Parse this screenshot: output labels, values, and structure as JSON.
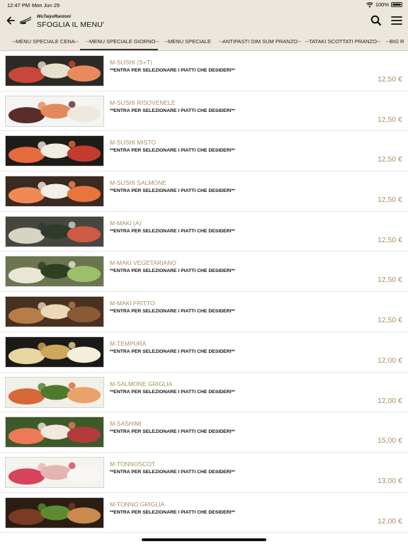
{
  "status": {
    "time": "12:47 PM",
    "date": "Mon Jun 29",
    "battery": "100%"
  },
  "header": {
    "brand": "WuTaiyoRanzoni",
    "title": "SFOGLIA IL MENU'"
  },
  "tabs": [
    {
      "label": "--MENU SPECIALE CENA--"
    },
    {
      "label": "--MENU SPECIALE GIORNO--"
    },
    {
      "label": "--MENU SPECIALE"
    },
    {
      "label": "--ANTIPASTI DIM SUM PRANZO--"
    },
    {
      "label": "--TATAKI SCOTTATI PRANZO--"
    },
    {
      "label": "--BIG R"
    }
  ],
  "items": [
    {
      "name": "M-SUSHI (S+T)",
      "desc": "**ENTRA PER SELEZIONARE I PIATTI CHE DESIDERI**",
      "price": "12,50 €",
      "colors": [
        "#2c2a24",
        "#c9463a",
        "#e8e0cf",
        "#e98a5e"
      ]
    },
    {
      "name": "M-SUSHI RISOVENELE",
      "desc": "**ENTRA PER SELEZIONARE I PIATTI CHE DESIDERI**",
      "price": "12,50 €",
      "colors": [
        "#f4f4f2",
        "#5a2d2a",
        "#e28a5b",
        "#efe9dd"
      ]
    },
    {
      "name": "M-SUSHI MISTO",
      "desc": "**ENTRA PER SELEZIONARE I PIATTI CHE DESIDERI**",
      "price": "12,50 €",
      "colors": [
        "#1e1c18",
        "#e56a3e",
        "#f1ece0",
        "#c63b2f"
      ]
    },
    {
      "name": "M-SUSHI SALMONE",
      "desc": "**ENTRA PER SELEZIONARE I PIATTI CHE DESIDERI**",
      "price": "12,50 €",
      "colors": [
        "#3a2a20",
        "#f08a55",
        "#f3efe6",
        "#e9743e"
      ]
    },
    {
      "name": "M-MAKI (A)",
      "desc": "**ENTRA PER SELEZIONARE I PIATTI CHE DESIDERI**",
      "price": "12,50 €",
      "colors": [
        "#474740",
        "#d8d4c4",
        "#2f3a2c",
        "#cf5a44"
      ]
    },
    {
      "name": "M-MAKI VEGETARIANO",
      "desc": "**ENTRA PER SELEZIONARE I PIATTI CHE DESIDERI**",
      "price": "12,50 €",
      "colors": [
        "#6b7650",
        "#eae6d6",
        "#2f3f26",
        "#9cc06a"
      ]
    },
    {
      "name": "M-MAKI FRITTO",
      "desc": "**ENTRA PER SELEZIONARE I PIATTI CHE DESIDERI**",
      "price": "12,50 €",
      "colors": [
        "#4a3020",
        "#b77d48",
        "#ead8b8",
        "#8a5a34"
      ]
    },
    {
      "name": "M-TEMPURA",
      "desc": "**ENTRA PER SELEZIONARE I PIATTI CHE DESIDERI**",
      "price": "12,00 €",
      "colors": [
        "#1b1a16",
        "#e8d6a0",
        "#cfa75a",
        "#f4eedb"
      ]
    },
    {
      "name": "M-SALMONE GRIGLIA",
      "desc": "**ENTRA PER SELEZIONARE I PIATTI CHE DESIDERI**",
      "price": "12,00 €",
      "colors": [
        "#f2efe6",
        "#d7683a",
        "#4f7a2c",
        "#e9a36a"
      ]
    },
    {
      "name": "M-SASHIMI",
      "desc": "**ENTRA PER SELEZIONARE I PIATTI CHE DESIDERI**",
      "price": "15,00 €",
      "colors": [
        "#3e5a2a",
        "#ec7a58",
        "#f2e8dc",
        "#b43b3c"
      ]
    },
    {
      "name": "M-TONNOSCOT",
      "desc": "**ENTRA PER SELEZIONARE I PIATTI CHE DESIDERI**",
      "price": "13,00 €",
      "colors": [
        "#f5f3ee",
        "#d6445c",
        "#e6b3b0",
        "#f9f7f3"
      ]
    },
    {
      "name": "M-TONNO GRIGLIA",
      "desc": "**ENTRA PER SELEZIONARE I PIATTI CHE DESIDERI**",
      "price": "12,00 €",
      "colors": [
        "#2a1d14",
        "#7a3a24",
        "#5c8a30",
        "#c88a4e"
      ]
    }
  ],
  "icons": {
    "back": "arrow-left-icon",
    "logo": "chopsticks-icon",
    "search": "search-icon",
    "menu": "hamburger-menu-icon",
    "wifi": "wifi-icon",
    "battery": "battery-icon"
  }
}
